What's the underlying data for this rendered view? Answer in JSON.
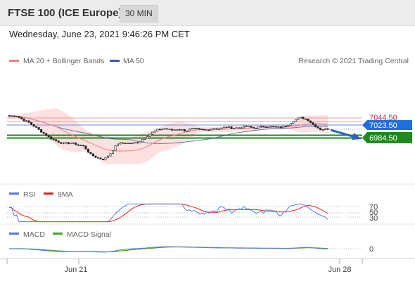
{
  "header": {
    "title": "FTSE 100 (ICE Europe)",
    "interval": "30 MIN"
  },
  "datetime": "Wednesday, June 23, 2021 9:46:26 PM CET",
  "legend": {
    "ma20": "MA 20 + Bollinger Bands",
    "ma50": "MA 50",
    "credit": "Research © 2021 Trading Central",
    "rsi": "RSI",
    "rsi_ma": "9MA",
    "macd": "MACD",
    "macd_signal": "MACD Signal"
  },
  "colors": {
    "ma20": "#f08080",
    "band": "#fde0e0",
    "ma50": "#3a5a9a",
    "price_tag": "#1f6fe0",
    "support": "#1e8a1e",
    "resistance": "#cc2222",
    "rsi": "#5577dd",
    "rsi_ma": "#dd2222",
    "macd": "#5577dd",
    "macd_signal": "#4aa02a",
    "forecast": "#2a66c8"
  },
  "chart_data": {
    "type": "candlestick",
    "x_ticks": [
      "Jun 21",
      "Jun 28"
    ],
    "y_ylim": [
      6900,
      7080
    ],
    "levels": {
      "resistance": {
        "value": 7044.5,
        "label": "7044.50"
      },
      "last_price": {
        "value": 7023.5,
        "label": "7023.50"
      },
      "support": {
        "value": 6984.5,
        "label": "6984.50"
      }
    },
    "price_path": [
      7050,
      7052,
      7040,
      7030,
      7015,
      7000,
      6985,
      6975,
      6968,
      6970,
      6965,
      6960,
      6935,
      6925,
      6920,
      6940,
      6968,
      6970,
      6968,
      6972,
      6985,
      7000,
      7010,
      7013,
      7008,
      7012,
      7006,
      7012,
      7010,
      7008,
      7014,
      7012,
      7018,
      7014,
      7016,
      7020,
      7014,
      7018,
      7020,
      7018,
      7016,
      7022,
      7038,
      7046,
      7040,
      7022,
      7010,
      7012
    ],
    "forecast_target": 6984.5,
    "rsi": {
      "levels": [
        70,
        50,
        30
      ],
      "level_labels": [
        "70",
        "50",
        "30"
      ]
    },
    "macd": {
      "zero_label": "0"
    }
  }
}
